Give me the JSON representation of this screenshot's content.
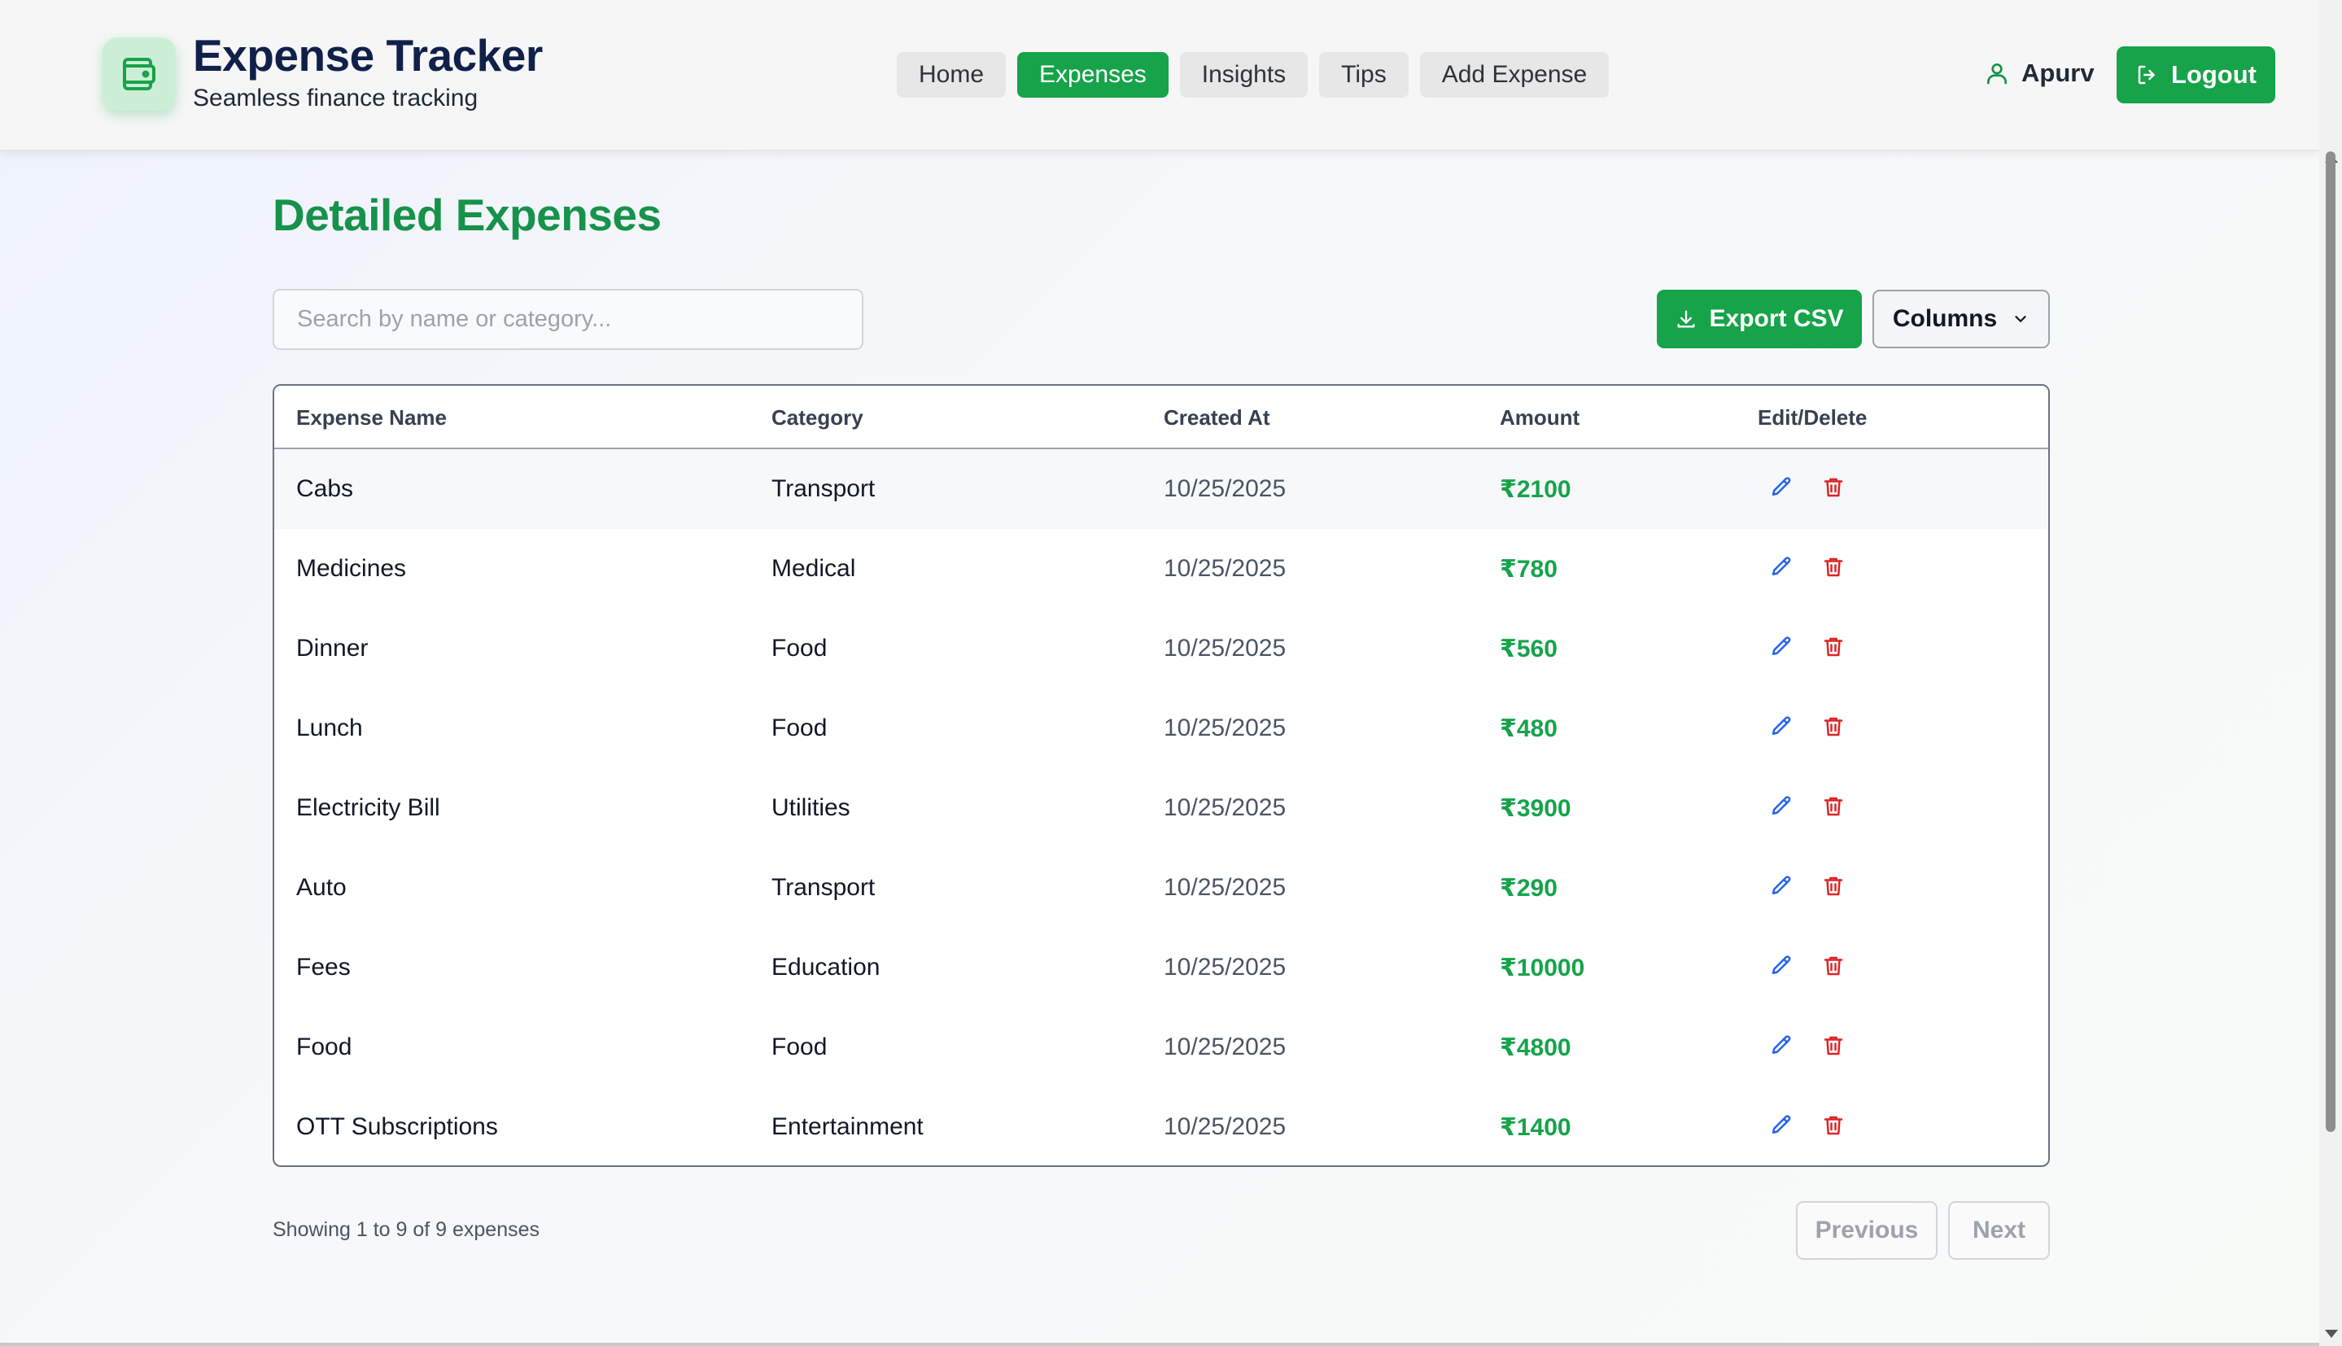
{
  "brand": {
    "title": "Expense Tracker",
    "subtitle": "Seamless finance tracking",
    "icon": "wallet-icon"
  },
  "nav": {
    "items": [
      {
        "label": "Home",
        "active": false
      },
      {
        "label": "Expenses",
        "active": true
      },
      {
        "label": "Insights",
        "active": false
      },
      {
        "label": "Tips",
        "active": false
      },
      {
        "label": "Add Expense",
        "active": false
      }
    ]
  },
  "user": {
    "name": "Apurv",
    "logout_label": "Logout"
  },
  "main": {
    "title": "Detailed Expenses",
    "search_placeholder": "Search by name or category...",
    "search_value": "",
    "export_label": "Export CSV",
    "columns_label": "Columns"
  },
  "table": {
    "headers": [
      "Expense Name",
      "Category",
      "Created At",
      "Amount",
      "Edit/Delete"
    ],
    "rows": [
      {
        "name": "Cabs",
        "category": "Transport",
        "date": "10/25/2025",
        "amount": "₹2100"
      },
      {
        "name": "Medicines",
        "category": "Medical",
        "date": "10/25/2025",
        "amount": "₹780"
      },
      {
        "name": "Dinner",
        "category": "Food",
        "date": "10/25/2025",
        "amount": "₹560"
      },
      {
        "name": "Lunch",
        "category": "Food",
        "date": "10/25/2025",
        "amount": "₹480"
      },
      {
        "name": "Electricity Bill",
        "category": "Utilities",
        "date": "10/25/2025",
        "amount": "₹3900"
      },
      {
        "name": "Auto",
        "category": "Transport",
        "date": "10/25/2025",
        "amount": "₹290"
      },
      {
        "name": "Fees",
        "category": "Education",
        "date": "10/25/2025",
        "amount": "₹10000"
      },
      {
        "name": "Food",
        "category": "Food",
        "date": "10/25/2025",
        "amount": "₹4800"
      },
      {
        "name": "OTT Subscriptions",
        "category": "Entertainment",
        "date": "10/25/2025",
        "amount": "₹1400"
      }
    ]
  },
  "pagination": {
    "summary": "Showing 1 to 9 of 9 expenses",
    "previous_label": "Previous",
    "next_label": "Next"
  },
  "colors": {
    "accent": "#16a34a",
    "title_green": "#16924a",
    "brand_navy": "#10204a",
    "edit_blue": "#2563eb",
    "delete_red": "#dc2626"
  }
}
